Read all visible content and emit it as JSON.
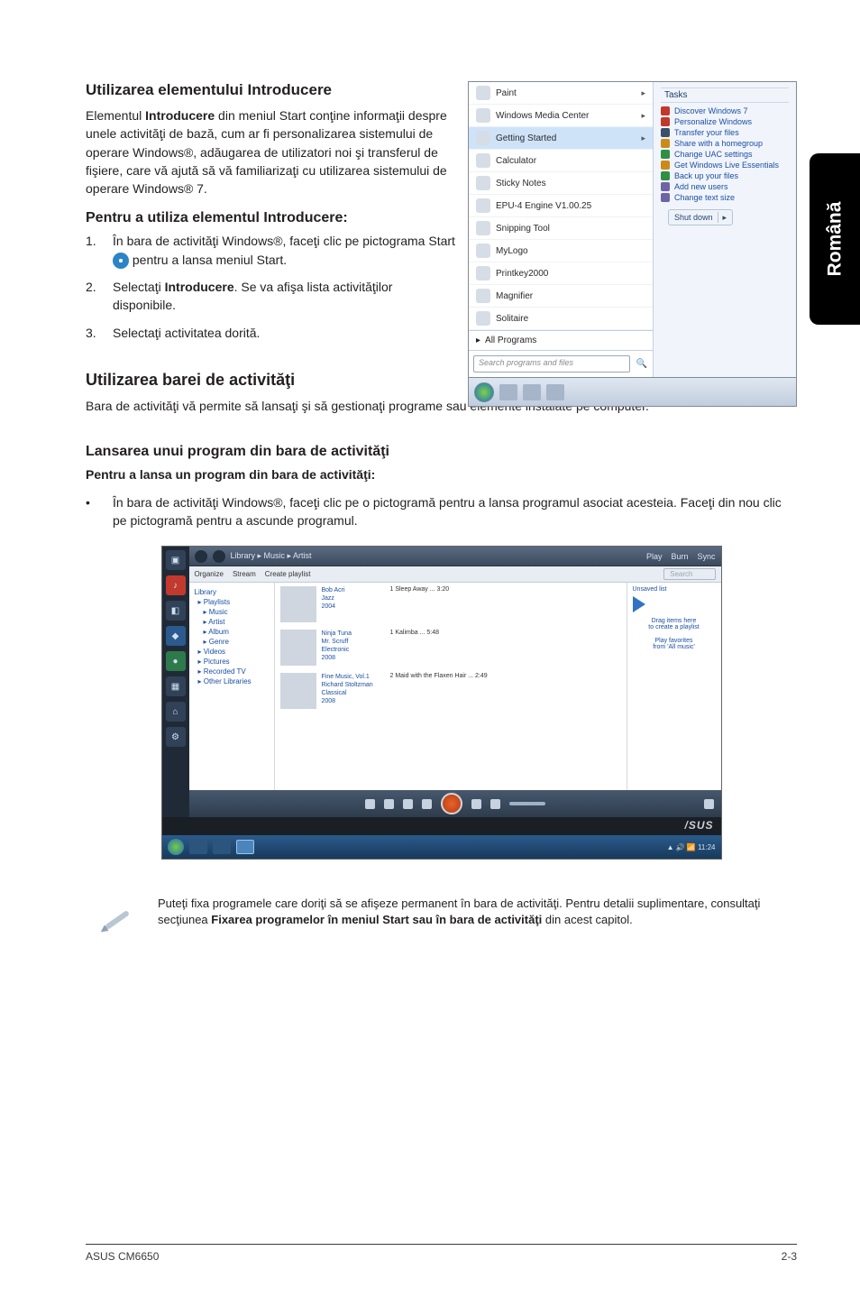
{
  "sidebar_tab": "Română",
  "sec1": {
    "heading": "Utilizarea elementului Introducere",
    "para": "Elementul Introducere din meniul Start conţine informaţii despre unele activităţi de bază, cum ar fi personalizarea sistemului de operare Windows®, adăugarea de utilizatori noi şi transferul de fişiere, care vă ajută să vă familiarizaţi cu utilizarea sistemului de operare Windows® 7.",
    "subheading": "Pentru a utiliza elementul Introducere:",
    "steps": [
      "În bara de activităţi Windows®, faceţi clic pe pictograma Start  pentru a lansa meniul Start.",
      "Selectaţi Introducere. Se va afişa lista activităţilor disponibile.",
      "Selectaţi activitatea dorită."
    ],
    "step1_pre": "În bara de activităţi Windows®, faceţi clic pe pictograma Start ",
    "step1_post": " pentru a lansa meniul Start.",
    "step2_pre": "Selectaţi ",
    "step2_bold": "Introducere",
    "step2_post": ". Se va afişa lista activităţilor disponibile."
  },
  "start_menu": {
    "left_items": [
      "Paint",
      "Windows Media Center",
      "Getting Started",
      "Calculator",
      "Sticky Notes",
      "EPU-4 Engine V1.00.25",
      "Snipping Tool",
      "MyLogo",
      "Printkey2000",
      "Magnifier",
      "Solitaire"
    ],
    "highlight_index": 2,
    "all_programs": "All Programs",
    "search_placeholder": "Search programs and files",
    "tasks_title": "Tasks",
    "tasks": [
      "Discover Windows 7",
      "Personalize Windows",
      "Transfer your files",
      "Share with a homegroup",
      "Change UAC settings",
      "Get Windows Live Essentials",
      "Back up your files",
      "Add new users",
      "Change text size"
    ],
    "task_colors": [
      "#c0392b",
      "#c0392b",
      "#3b5169",
      "#cc8a1a",
      "#2f8f45",
      "#cc8a1a",
      "#2f8f45",
      "#6f63a8",
      "#6f63a8"
    ],
    "shutdown": "Shut down"
  },
  "sec2": {
    "heading": "Utilizarea barei de activităţi",
    "para": "Bara de activităţi vă permite să lansaţi şi să gestionaţi programe sau elemente instalate pe computer."
  },
  "sec3": {
    "heading": "Lansarea unui program din bara de activităţi",
    "subheading": "Pentru a lansa un program din bara de activităţi:",
    "bullet": "În bara de activităţi Windows®, faceţi clic pe o pictogramă pentru a lansa programul asociat acesteia. Faceţi din nou clic pe pictogramă pentru a ascunde programul."
  },
  "wmp": {
    "breadcrumb": "Library ▸ Music ▸ Artist",
    "menu": [
      "Organize",
      "Stream",
      "Create playlist"
    ],
    "search_ph": "Search",
    "tabs": [
      "Play",
      "Burn",
      "Sync"
    ],
    "nav": [
      "Library",
      "Playlists",
      "Music",
      "Artist",
      "Album",
      "Genre",
      "Videos",
      "Pictures",
      "Recorded TV",
      "Other Libraries"
    ],
    "rows": [
      {
        "artist": "Bob Acri",
        "meta": "Bob Acri\nJazz\n2004",
        "tracks": "1   Sleep Away        ...   3:20"
      },
      {
        "artist": "Mr. Scruff",
        "meta": "Ninja Tuna\nMr. Scruff\nElectronic\n2008",
        "tracks": "1   Kalimba        ...   5:48"
      },
      {
        "artist": "Richard Stoltzman",
        "meta": "Fine Music, Vol.1\nRichard Stoltzman\nClassical\n2008",
        "tracks": "2   Maid with the Flaxen Hair   ...   2:49"
      }
    ],
    "right_title": "Unsaved list",
    "right_hint1": "Drag items here\nto create a playlist",
    "right_hint2": "Play favorites\nfrom 'All music'",
    "brand": "/SUS",
    "tray": "▲ 🔊 📶 11:24"
  },
  "note": {
    "pre": "Puteţi fixa programele care doriţi să se afişeze permanent în bara de activităţi. Pentru detalii suplimentare, consultaţi secţiunea ",
    "bold": "Fixarea programelor în meniul Start sau în bara de activităţi",
    "post": " din acest capitol."
  },
  "footer": {
    "left": "ASUS CM6650",
    "right": "2-3"
  }
}
